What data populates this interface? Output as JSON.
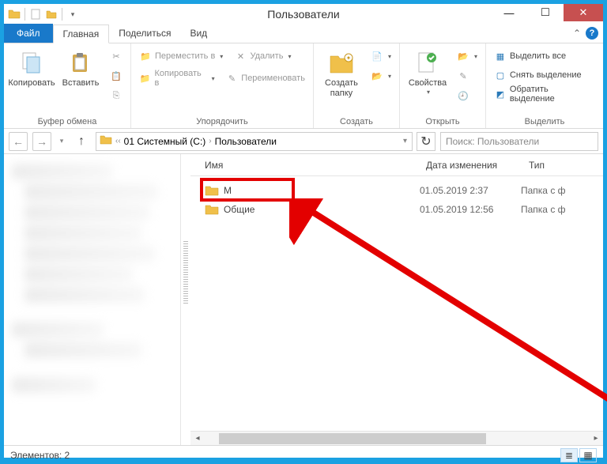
{
  "title": "Пользователи",
  "tabs": {
    "file": "Файл",
    "home": "Главная",
    "share": "Поделиться",
    "view": "Вид"
  },
  "ribbon": {
    "clipboard": {
      "copy": "Копировать",
      "paste": "Вставить",
      "label": "Буфер обмена"
    },
    "organize": {
      "move_to": "Переместить в",
      "copy_to": "Копировать в",
      "delete": "Удалить",
      "rename": "Переименовать",
      "label": "Упорядочить"
    },
    "new": {
      "new_folder": "Создать папку",
      "label": "Создать"
    },
    "open": {
      "properties": "Свойства",
      "label": "Открыть"
    },
    "select": {
      "select_all": "Выделить все",
      "select_none": "Снять выделение",
      "invert": "Обратить выделение",
      "label": "Выделить"
    }
  },
  "breadcrumb": {
    "part1": "01 Системный (C:)",
    "part2": "Пользователи"
  },
  "search_placeholder": "Поиск: Пользователи",
  "columns": {
    "name": "Имя",
    "date": "Дата изменения",
    "type": "Тип"
  },
  "rows": [
    {
      "name": "M",
      "date": "01.05.2019 2:37",
      "type": "Папка с ф"
    },
    {
      "name": "Общие",
      "date": "01.05.2019 12:56",
      "type": "Папка с ф"
    }
  ],
  "status": "Элементов: 2"
}
